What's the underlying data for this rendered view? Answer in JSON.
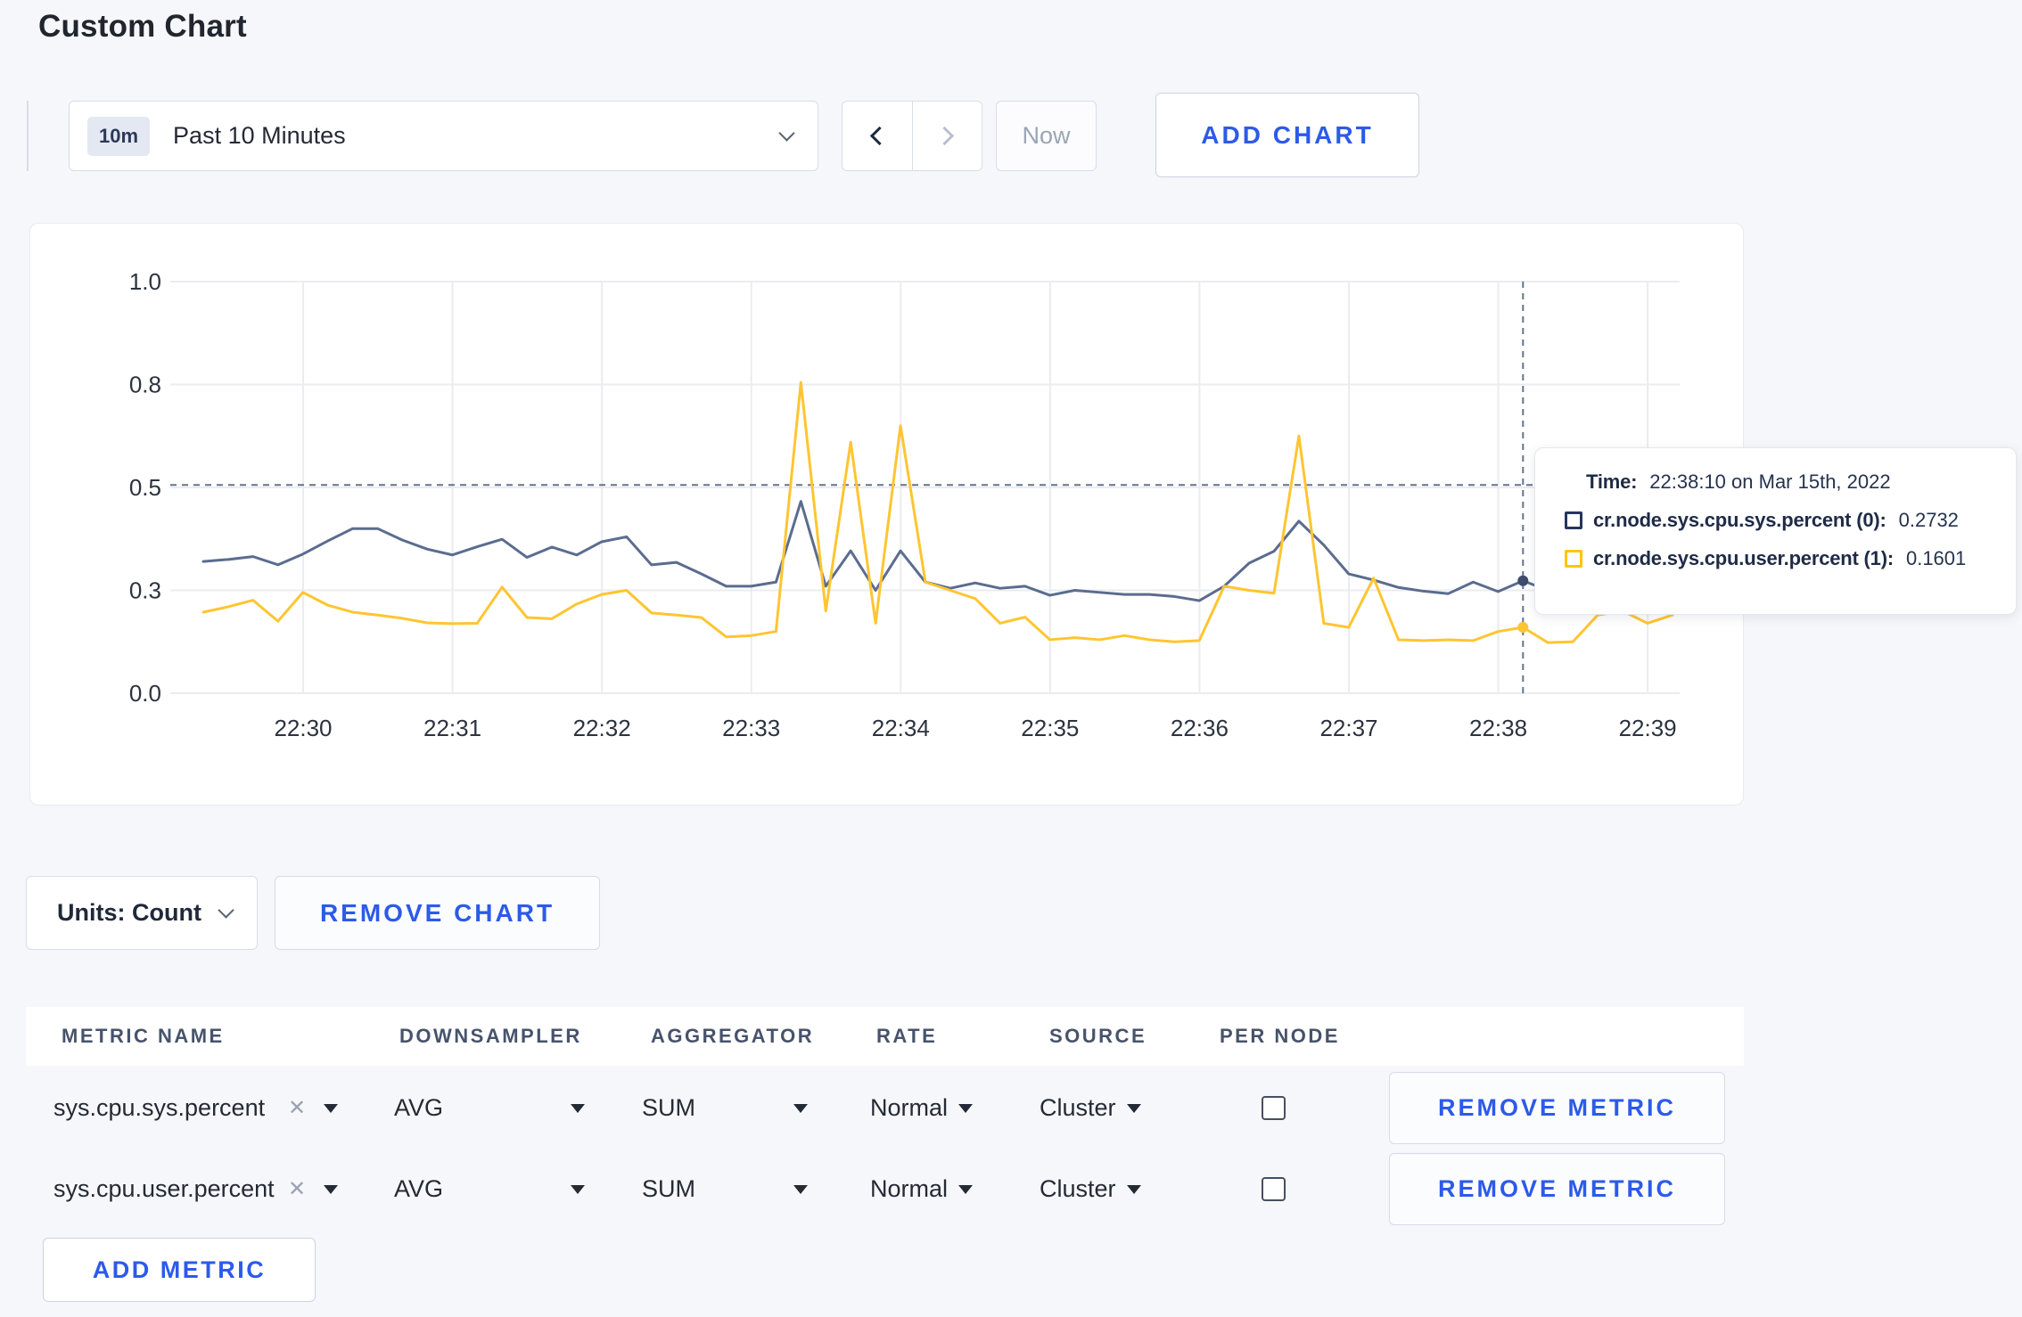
{
  "page": {
    "title": "Custom Chart"
  },
  "toolbar": {
    "range_badge": "10m",
    "range_label": "Past 10 Minutes",
    "now_label": "Now",
    "add_chart_label": "ADD CHART"
  },
  "theme": {
    "accent_blue": "#2c5ae9",
    "page_background": "#f6f7fa",
    "card_background": "#ffffff",
    "gridline_color": "#ebecf0",
    "crosshair_color": "#64748c"
  },
  "chart_data": {
    "type": "line",
    "title": "",
    "xlabel": "",
    "ylabel": "",
    "ylim": [
      0,
      1
    ],
    "grid": true,
    "x_ticks": [
      "22:30",
      "22:31",
      "22:32",
      "22:33",
      "22:34",
      "22:35",
      "22:36",
      "22:37",
      "22:38",
      "22:39"
    ],
    "y_ticks": [
      {
        "label": "0.0",
        "value": 0
      },
      {
        "label": "0.3",
        "value": 0.25
      },
      {
        "label": "0.5",
        "value": 0.5
      },
      {
        "label": "0.8",
        "value": 0.75
      },
      {
        "label": "1.0",
        "value": 1.0
      }
    ],
    "x_start": "22:29:20",
    "x_step_seconds": 10,
    "series": [
      {
        "name": "cr.node.sys.cpu.sys.percent",
        "color": "#5b6c8f",
        "values": [
          0.32,
          0.325,
          0.332,
          0.312,
          0.338,
          0.37,
          0.4,
          0.4,
          0.372,
          0.35,
          0.336,
          0.356,
          0.374,
          0.33,
          0.355,
          0.336,
          0.368,
          0.38,
          0.312,
          0.318,
          0.29,
          0.26,
          0.26,
          0.27,
          0.466,
          0.26,
          0.346,
          0.25,
          0.346,
          0.27,
          0.255,
          0.268,
          0.255,
          0.26,
          0.238,
          0.25,
          0.245,
          0.24,
          0.24,
          0.235,
          0.225,
          0.26,
          0.316,
          0.345,
          0.418,
          0.36,
          0.29,
          0.275,
          0.257,
          0.248,
          0.242,
          0.27,
          0.247,
          0.2732,
          0.25,
          0.26,
          0.27,
          0.285,
          0.3,
          0.305
        ]
      },
      {
        "name": "cr.node.sys.cpu.user.percent",
        "color": "#ffc531",
        "values": [
          0.197,
          0.21,
          0.226,
          0.175,
          0.245,
          0.214,
          0.197,
          0.19,
          0.182,
          0.171,
          0.169,
          0.17,
          0.258,
          0.184,
          0.181,
          0.217,
          0.24,
          0.25,
          0.195,
          0.19,
          0.184,
          0.137,
          0.14,
          0.15,
          0.755,
          0.2,
          0.61,
          0.17,
          0.65,
          0.27,
          0.25,
          0.23,
          0.17,
          0.185,
          0.13,
          0.135,
          0.13,
          0.14,
          0.13,
          0.125,
          0.128,
          0.26,
          0.25,
          0.243,
          0.625,
          0.17,
          0.16,
          0.28,
          0.13,
          0.128,
          0.13,
          0.128,
          0.15,
          0.1601,
          0.123,
          0.125,
          0.19,
          0.2,
          0.17,
          0.19
        ]
      }
    ],
    "crosshair": {
      "index": 53,
      "time": "22:38:10",
      "mouse_value": 0.506
    },
    "legend_position": "tooltip"
  },
  "tooltip": {
    "time_label": "Time:",
    "time_value": "22:38:10 on Mar 15th, 2022",
    "rows": [
      {
        "label": "cr.node.sys.cpu.sys.percent (0):",
        "value": "0.2732",
        "swatch_color": "#26355b"
      },
      {
        "label": "cr.node.sys.cpu.user.percent (1):",
        "value": "0.1601",
        "swatch_color": "#ffc400"
      }
    ]
  },
  "chart_controls": {
    "units_label": "Units: Count",
    "remove_chart_label": "REMOVE CHART"
  },
  "metrics_table": {
    "headers": {
      "metric": "METRIC NAME",
      "downsampler": "DOWNSAMPLER",
      "aggregator": "AGGREGATOR",
      "rate": "RATE",
      "source": "SOURCE",
      "per_node": "PER NODE"
    },
    "rows": [
      {
        "metric": "sys.cpu.sys.percent",
        "remove_icon": "✕",
        "downsampler": "AVG",
        "aggregator": "SUM",
        "rate": "Normal",
        "source": "Cluster",
        "per_node_checked": false,
        "remove_label": "REMOVE METRIC"
      },
      {
        "metric": "sys.cpu.user.percent",
        "remove_icon": "✕",
        "downsampler": "AVG",
        "aggregator": "SUM",
        "rate": "Normal",
        "source": "Cluster",
        "per_node_checked": false,
        "remove_label": "REMOVE METRIC"
      }
    ],
    "add_metric_label": "ADD METRIC"
  }
}
